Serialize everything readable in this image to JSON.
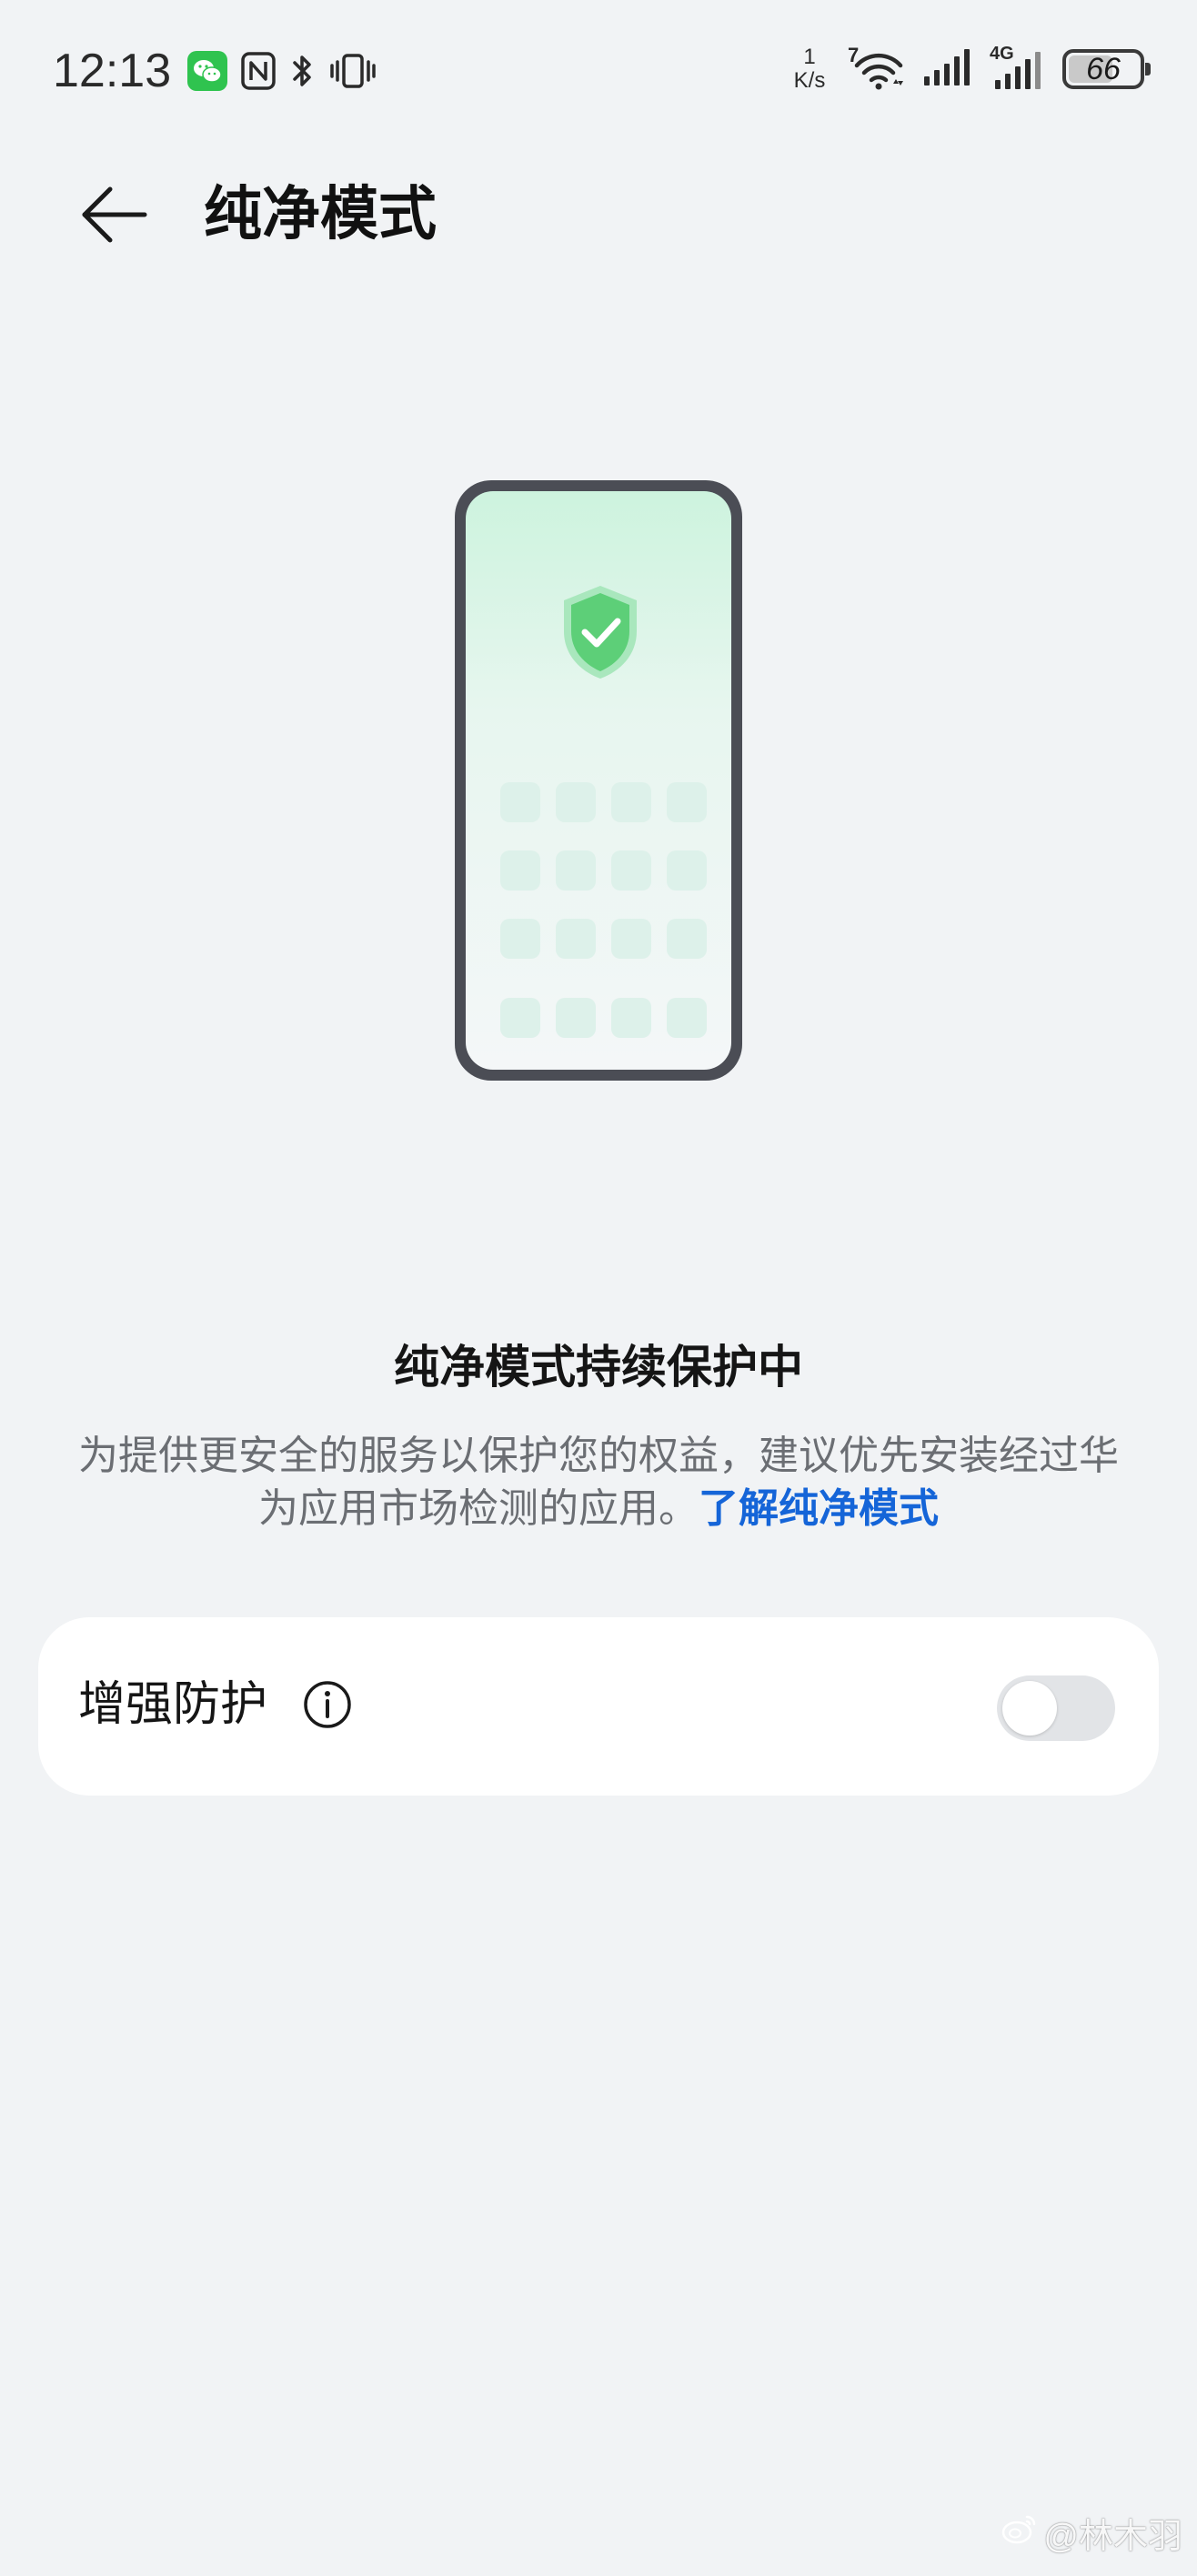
{
  "status_bar": {
    "time": "12:13",
    "speed_value": "1",
    "speed_unit": "K/s",
    "wifi_badge": "7",
    "mobile_badge": "4G",
    "battery": "66",
    "battery_level": 0.66,
    "icons": [
      "wechat-icon",
      "nfc-icon",
      "bluetooth-icon",
      "vibrate-icon",
      "wifi-icon",
      "signal-icon",
      "signal-4g-icon",
      "battery-icon"
    ]
  },
  "header": {
    "title": "纯净模式"
  },
  "main": {
    "status_heading": "纯净模式持续保护中",
    "description": "为提供更安全的服务以保护您的权益，建议优先安装经过华为应用市场检测的应用。",
    "learn_more_link": "了解纯净模式"
  },
  "settings": {
    "enhanced_protection_label": "增强防护",
    "enhanced_protection_enabled": false
  },
  "watermark": {
    "text": "@林木羽"
  },
  "colors": {
    "background": "#f1f3f5",
    "link": "#1565d8",
    "shield_green": "#5dcf78",
    "toggle_off": "#e2e4e7"
  }
}
